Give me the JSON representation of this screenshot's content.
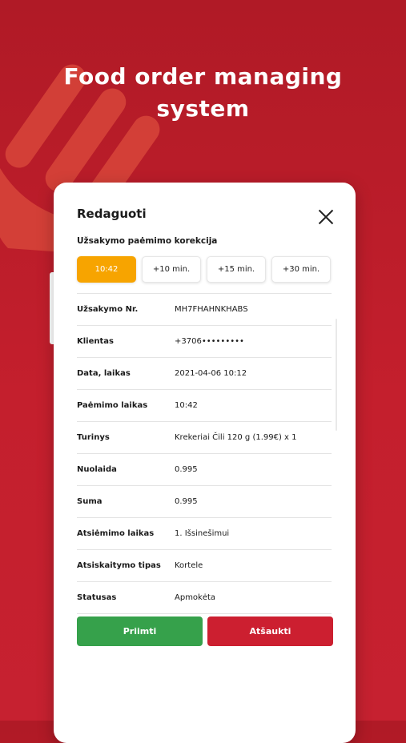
{
  "hero": {
    "title": "Food order managing\nsystem"
  },
  "dialog": {
    "title": "Redaguoti",
    "pickup_correction_label": "Užsakymo paėmimo korekcija",
    "time_chips": [
      {
        "label": "10:42",
        "selected": true
      },
      {
        "label": "+10 min.",
        "selected": false
      },
      {
        "label": "+15 min.",
        "selected": false
      },
      {
        "label": "+30 min.",
        "selected": false
      }
    ],
    "rows": [
      {
        "key": "Užsakymo Nr.",
        "value": "MH7FHAHNKHABS"
      },
      {
        "key": "Klientas",
        "value": "+3706•••••••••"
      },
      {
        "key": "Data, laikas",
        "value": "2021-04-06 10:12"
      },
      {
        "key": "Paėmimo laikas",
        "value": "10:42"
      },
      {
        "key": "Turinys",
        "value": "Krekeriai Čili 120 g (1.99€) x 1"
      },
      {
        "key": "Nuolaida",
        "value": "0.995"
      },
      {
        "key": "Suma",
        "value": "0.995"
      },
      {
        "key": "Atsiėmimo laikas",
        "value": "1. Išsinešimui"
      },
      {
        "key": "Atsiskaitymo tipas",
        "value": "Kortele"
      },
      {
        "key": "Statusas",
        "value": "Apmokėta"
      }
    ],
    "accept_label": "Priimti",
    "cancel_label": "Atšaukti"
  },
  "colors": {
    "background": "#c41f2d",
    "accent_orange": "#f7a400",
    "accept_green": "#36a14b",
    "cancel_red": "#cc1f30"
  },
  "icons": {
    "close": "close-icon",
    "decor": "fork-icon"
  }
}
